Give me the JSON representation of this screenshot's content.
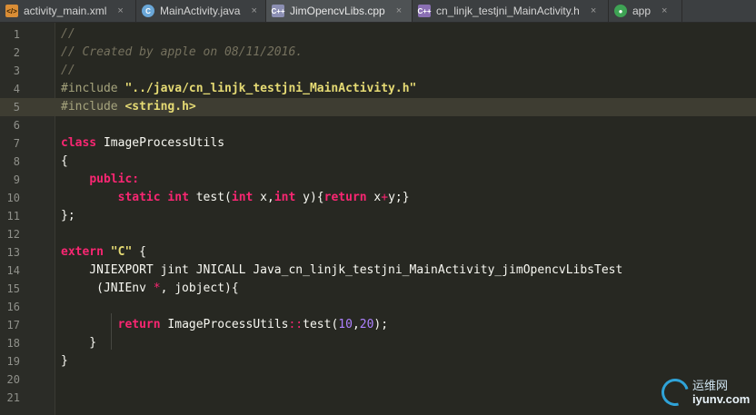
{
  "tabs": [
    {
      "label": "activity_main.xml",
      "icon": "xml-file-icon",
      "glyph": "</>",
      "kind": "xml",
      "active": false
    },
    {
      "label": "MainActivity.java",
      "icon": "java-class-icon",
      "glyph": "C",
      "kind": "java",
      "active": false
    },
    {
      "label": "JimOpencvLibs.cpp",
      "icon": "cpp-file-icon",
      "glyph": "C++",
      "kind": "cpp",
      "active": true
    },
    {
      "label": "cn_linjk_testjni_MainActivity.h",
      "icon": "header-file-icon",
      "glyph": "C++",
      "kind": "h",
      "active": false
    },
    {
      "label": "app",
      "icon": "android-module-icon",
      "glyph": "●",
      "kind": "app",
      "active": false
    }
  ],
  "tab_close_glyph": "×",
  "current_line": 5,
  "lines": [
    {
      "num": "1",
      "segments": [
        {
          "t": "//",
          "c": "comment"
        }
      ]
    },
    {
      "num": "2",
      "segments": [
        {
          "t": "// Created by apple on 08/11/2016.",
          "c": "comment"
        }
      ]
    },
    {
      "num": "3",
      "segments": [
        {
          "t": "//",
          "c": "comment"
        }
      ]
    },
    {
      "num": "4",
      "segments": [
        {
          "t": "#include ",
          "c": "pre"
        },
        {
          "t": "\"../java/cn_linjk_testjni_MainActivity.h\"",
          "c": "str"
        }
      ]
    },
    {
      "num": "5",
      "segments": [
        {
          "t": "#include ",
          "c": "pre"
        },
        {
          "t": "<string.h>",
          "c": "str"
        }
      ]
    },
    {
      "num": "6",
      "segments": []
    },
    {
      "num": "7",
      "segments": [
        {
          "t": "class",
          "c": "kw"
        },
        {
          "t": " ImageProcessUtils",
          "c": ""
        }
      ]
    },
    {
      "num": "8",
      "segments": [
        {
          "t": "{",
          "c": ""
        }
      ]
    },
    {
      "num": "9",
      "segments": [
        {
          "t": "    ",
          "c": ""
        },
        {
          "t": "public:",
          "c": "kw"
        }
      ]
    },
    {
      "num": "10",
      "segments": [
        {
          "t": "        ",
          "c": ""
        },
        {
          "t": "static int",
          "c": "kw"
        },
        {
          "t": " test(",
          "c": ""
        },
        {
          "t": "int",
          "c": "type"
        },
        {
          "t": " x,",
          "c": ""
        },
        {
          "t": "int",
          "c": "type"
        },
        {
          "t": " y){",
          "c": ""
        },
        {
          "t": "return",
          "c": "kw"
        },
        {
          "t": " x",
          "c": ""
        },
        {
          "t": "+",
          "c": "op"
        },
        {
          "t": "y;}",
          "c": ""
        }
      ]
    },
    {
      "num": "11",
      "segments": [
        {
          "t": "};",
          "c": ""
        }
      ]
    },
    {
      "num": "12",
      "segments": []
    },
    {
      "num": "13",
      "segments": [
        {
          "t": "extern",
          "c": "kw"
        },
        {
          "t": " ",
          "c": ""
        },
        {
          "t": "\"C\"",
          "c": "str"
        },
        {
          "t": " {",
          "c": ""
        }
      ]
    },
    {
      "num": "14",
      "segments": [
        {
          "t": "    JNIEXPORT jint JNICALL Java_cn_linjk_testjni_MainActivity_jimOpencvLibsTest",
          "c": ""
        }
      ]
    },
    {
      "num": "15",
      "segments": [
        {
          "t": "     (JNIEnv ",
          "c": ""
        },
        {
          "t": "*",
          "c": "op"
        },
        {
          "t": ", jobject){",
          "c": ""
        }
      ]
    },
    {
      "num": "16",
      "segments": []
    },
    {
      "num": "17",
      "segments": [
        {
          "t": "        ",
          "c": ""
        },
        {
          "t": "return",
          "c": "kw"
        },
        {
          "t": " ImageProcessUtils",
          "c": ""
        },
        {
          "t": "::",
          "c": "op"
        },
        {
          "t": "test(",
          "c": ""
        },
        {
          "t": "10",
          "c": "num"
        },
        {
          "t": ",",
          "c": ""
        },
        {
          "t": "20",
          "c": "num"
        },
        {
          "t": ");",
          "c": ""
        }
      ]
    },
    {
      "num": "18",
      "segments": [
        {
          "t": "    }",
          "c": ""
        }
      ]
    },
    {
      "num": "19",
      "segments": [
        {
          "t": "}",
          "c": ""
        }
      ]
    },
    {
      "num": "20",
      "segments": []
    },
    {
      "num": "21",
      "segments": []
    }
  ],
  "watermark": {
    "cn": "运维网",
    "url": "iyunv.com"
  }
}
